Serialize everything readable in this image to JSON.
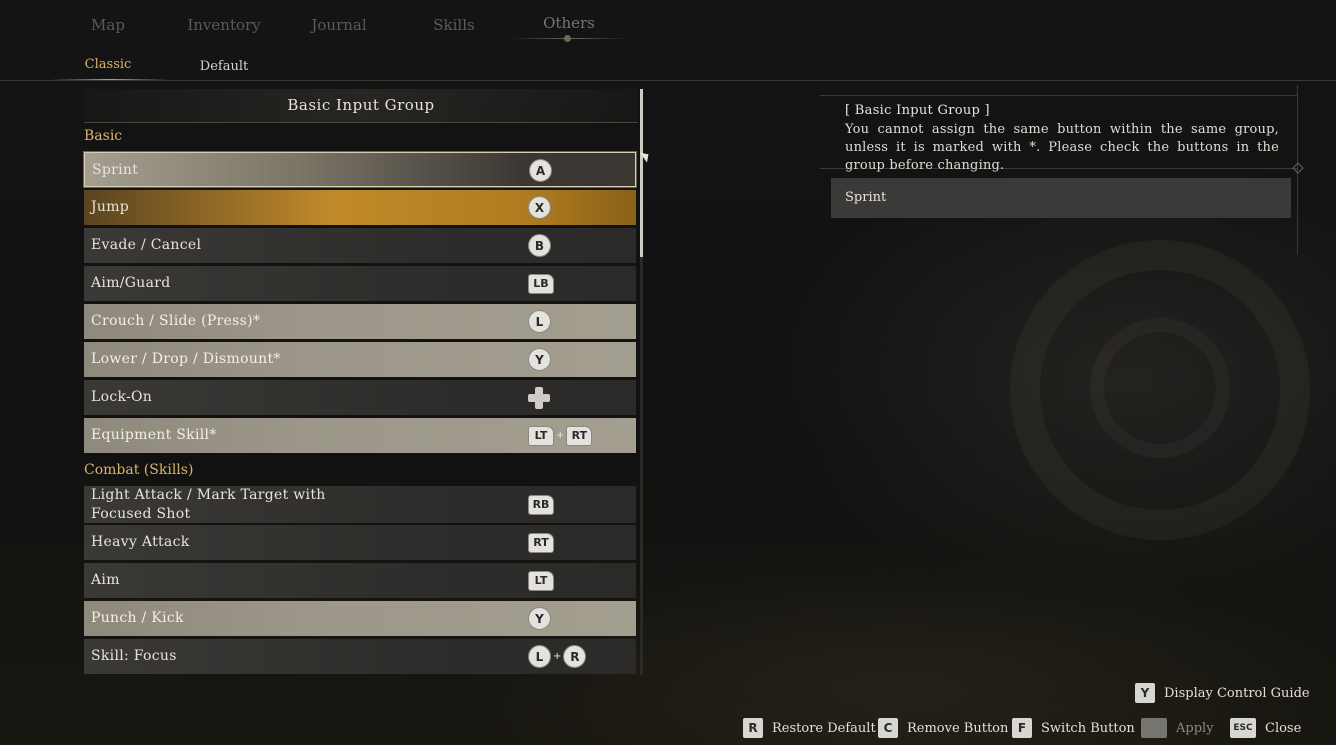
{
  "top_tabs": [
    {
      "label": "Map",
      "active": false
    },
    {
      "label": "Inventory",
      "active": false
    },
    {
      "label": "Journal",
      "active": false
    },
    {
      "label": "Skills",
      "active": false
    },
    {
      "label": "Others",
      "active": true
    }
  ],
  "sub_tabs": [
    {
      "label": "Classic",
      "active": true
    },
    {
      "label": "Default",
      "active": false
    }
  ],
  "panel": {
    "header": "Basic Input Group",
    "sections": [
      {
        "title": "Basic"
      },
      {
        "title": "Combat (Skills)"
      }
    ],
    "rows": [
      {
        "label": "Sprint",
        "buttons": [
          "A"
        ],
        "state": "selected"
      },
      {
        "label": "Jump",
        "buttons": [
          "X"
        ],
        "state": "highlighted"
      },
      {
        "label": "Evade / Cancel",
        "buttons": [
          "B"
        ],
        "state": "normal"
      },
      {
        "label": "Aim/Guard",
        "buttons": [
          "LB"
        ],
        "state": "normal"
      },
      {
        "label": "Crouch / Slide (Press)*",
        "buttons": [
          "L"
        ],
        "state": "group"
      },
      {
        "label": "Lower / Drop / Dismount*",
        "buttons": [
          "Y"
        ],
        "state": "group"
      },
      {
        "label": "Lock-On",
        "buttons": [
          "D-pad"
        ],
        "state": "normal"
      },
      {
        "label": "Equipment Skill*",
        "buttons": [
          "LT",
          "RT"
        ],
        "state": "group"
      },
      {
        "label_line1": "Light Attack / Mark Target with",
        "label_line2": "Focused Shot",
        "buttons": [
          "RB"
        ],
        "state": "normal"
      },
      {
        "label": "Heavy Attack",
        "buttons": [
          "RT"
        ],
        "state": "normal"
      },
      {
        "label": "Aim",
        "buttons": [
          "LT"
        ],
        "state": "normal"
      },
      {
        "label": "Punch / Kick",
        "buttons": [
          "Y"
        ],
        "state": "group"
      },
      {
        "label": "Skill: Focus",
        "buttons": [
          "L",
          "R"
        ],
        "state": "normal"
      }
    ]
  },
  "info": {
    "title": "[ Basic Input Group ]",
    "text": "You cannot assign the same button within the same group, unless it is marked with *. Please check the buttons in the group before changing.",
    "selected_action": "Sprint"
  },
  "hints": {
    "display_guide": {
      "key": "Y",
      "label": "Display Control Guide"
    },
    "restore": {
      "key": "R",
      "label": "Restore Default"
    },
    "remove": {
      "key": "C",
      "label": "Remove Button"
    },
    "switch": {
      "key": "F",
      "label": "Switch Button"
    },
    "apply": {
      "key": "",
      "label": "Apply"
    },
    "close": {
      "key": "ESC",
      "label": "Close"
    }
  },
  "colors": {
    "accent_gold": "#d9b56a",
    "jump_highlight": "#c08a28",
    "row_dark": "#2f2d2b",
    "row_light": "#9c978a"
  }
}
